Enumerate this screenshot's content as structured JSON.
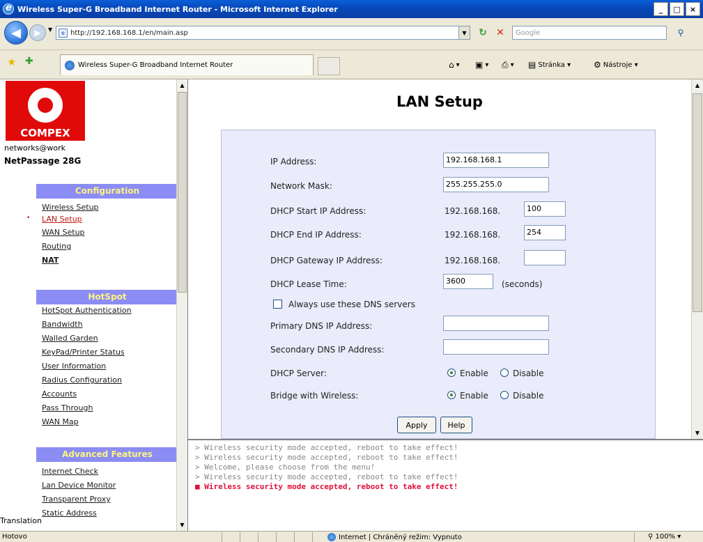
{
  "window": {
    "title": "Wireless Super-G Broadband Internet Router - Microsoft Internet Explorer",
    "min_label": "_",
    "max_label": "□",
    "close_label": "×"
  },
  "addressbar": {
    "url": "http://192.168.168.1/en/main.asp",
    "search_placeholder": "Google"
  },
  "tabbar": {
    "tab_title": "Wireless Super-G Broadband Internet Router",
    "cmd_page": "Stránka",
    "cmd_tools": "Nástroje"
  },
  "sidebar": {
    "logo_text": "COMPEX",
    "tagline": "networks@work",
    "model": "NetPassage 28G",
    "sections": [
      {
        "title": "Configuration",
        "items": [
          "Wireless Setup",
          "LAN Setup",
          "WAN Setup",
          "Routing",
          "NAT"
        ]
      },
      {
        "title": "HotSpot",
        "items": [
          "HotSpot Authentication",
          "Bandwidth",
          "Walled Garden",
          "KeyPad/Printer Status",
          "User Information",
          "Radius Configuration",
          "Accounts",
          "Pass Through",
          "WAN Map"
        ]
      },
      {
        "title": "Advanced Features",
        "items": [
          "Internet Check",
          "Lan Device Monitor",
          "Transparent Proxy",
          "Static Address"
        ]
      }
    ],
    "translation": "Translation"
  },
  "main": {
    "title": "LAN Setup",
    "ip_label": "IP Address:",
    "ip_value": "192.168.168.1",
    "mask_label": "Network Mask:",
    "mask_value": "255.255.255.0",
    "dhcp_start_label": "DHCP Start IP Address:",
    "dhcp_start_prefix": "192.168.168.",
    "dhcp_start_value": "100",
    "dhcp_end_label": "DHCP End IP Address:",
    "dhcp_end_prefix": "192.168.168.",
    "dhcp_end_value": "254",
    "dhcp_gw_label": "DHCP Gateway IP Address:",
    "dhcp_gw_prefix": "192.168.168.",
    "dhcp_gw_value": "",
    "lease_label": "DHCP Lease Time:",
    "lease_value": "3600",
    "lease_unit": "(seconds)",
    "dns_checkbox_label": "Always use these DNS servers",
    "dns_checkbox_checked": false,
    "primary_dns_label": "Primary DNS IP Address:",
    "primary_dns_value": "",
    "secondary_dns_label": "Secondary DNS IP Address:",
    "secondary_dns_value": "",
    "dhcp_server_label": "DHCP Server:",
    "bridge_label": "Bridge with Wireless:",
    "enable_label": "Enable",
    "disable_label": "Disable",
    "dhcp_server_selected": "Enable",
    "bridge_selected": "Enable",
    "apply_label": "Apply",
    "help_label": "Help"
  },
  "console": {
    "lines": [
      "> Wireless security mode accepted, reboot to take effect!",
      "> Wireless security mode accepted, reboot to take effect!",
      "> Welcome, please choose from the menu!",
      "> Wireless security mode accepted, reboot to take effect!",
      "■ Wireless security mode accepted, reboot to take effect!"
    ]
  },
  "statusbar": {
    "text": "Hotovo",
    "zone": "Internet | Chráněný režim: Vypnuto",
    "zoom": "100%"
  },
  "colors": {
    "section_header_bg": "#8c8cf5",
    "section_header_text": "#fcf580",
    "panel_bg": "#eaebfb",
    "logo_red": "#e10a0a",
    "console_highlight": "#e0103a"
  }
}
